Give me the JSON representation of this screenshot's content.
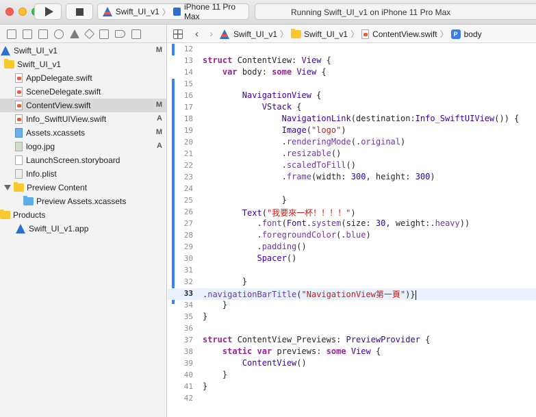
{
  "toolbar": {
    "scheme_name": "Swift_UI_v1",
    "scheme_separator": "〉",
    "device_name": "iPhone 11 Pro Max",
    "status_text": "Running Swift_UI_v1 on iPhone 11 Pro Max"
  },
  "navigator": {
    "tabs": [
      "folder-icon",
      "source-control-icon",
      "symbol-icon",
      "find-icon",
      "issue-icon",
      "test-icon",
      "debug-icon",
      "breakpoint-icon",
      "report-icon"
    ],
    "items": [
      {
        "label": "Swift_UI_v1",
        "badge": "M",
        "kind": "project",
        "indent": 0
      },
      {
        "label": "Swift_UI_v1",
        "badge": "",
        "kind": "folder",
        "indent": 1
      },
      {
        "label": "AppDelegate.swift",
        "badge": "",
        "kind": "swift",
        "indent": 2
      },
      {
        "label": "SceneDelegate.swift",
        "badge": "",
        "kind": "swift",
        "indent": 2
      },
      {
        "label": "ContentView.swift",
        "badge": "M",
        "kind": "swift",
        "indent": 2,
        "selected": true
      },
      {
        "label": "Info_SwiftUIView.swift",
        "badge": "A",
        "kind": "swift",
        "indent": 2
      },
      {
        "label": "Assets.xcassets",
        "badge": "M",
        "kind": "xcassets",
        "indent": 2
      },
      {
        "label": "logo.jpg",
        "badge": "A",
        "kind": "img",
        "indent": 2
      },
      {
        "label": "LaunchScreen.storyboard",
        "badge": "",
        "kind": "sb",
        "indent": 2
      },
      {
        "label": "Info.plist",
        "badge": "",
        "kind": "plist",
        "indent": 2
      },
      {
        "label": "Preview Content",
        "badge": "",
        "kind": "folder-open",
        "indent": 1
      },
      {
        "label": "Preview Assets.xcassets",
        "badge": "",
        "kind": "folder-blue",
        "indent": 3
      },
      {
        "label": "Products",
        "badge": "",
        "kind": "folder",
        "indent": 0
      },
      {
        "label": "Swift_UI_v1.app",
        "badge": "",
        "kind": "app",
        "indent": 2
      }
    ]
  },
  "jumpbar": {
    "path": [
      "Swift_UI_v1",
      "Swift_UI_v1",
      "ContentView.swift",
      "body"
    ],
    "symbol_badge": "P"
  },
  "editor": {
    "current_line": 33,
    "lines": [
      {
        "n": 12,
        "code": ""
      },
      {
        "n": 13,
        "code": "<span class=\"kw\">struct</span> ContentView: <span class=\"ty\">View</span> {"
      },
      {
        "n": 14,
        "code": "    <span class=\"kw\">var</span> body: <span class=\"kw\">some</span> <span class=\"ty\">View</span> {"
      },
      {
        "n": 15,
        "code": ""
      },
      {
        "n": 16,
        "code": "        <span class=\"ty\">NavigationView</span> {"
      },
      {
        "n": 17,
        "code": "            <span class=\"ty\">VStack</span> {"
      },
      {
        "n": 18,
        "code": "                <span class=\"ty\">NavigationLink</span>(destination:<span class=\"ty\">Info_SwiftUIView</span>()) {"
      },
      {
        "n": 19,
        "code": "                <span class=\"ty\">Image</span>(<span class=\"st\">\"logo\"</span>)"
      },
      {
        "n": 20,
        "code": "                .<span class=\"fn\">renderingMode</span>(.<span class=\"fn\">original</span>)"
      },
      {
        "n": 21,
        "code": "                .<span class=\"fn\">resizable</span>()"
      },
      {
        "n": 22,
        "code": "                .<span class=\"fn\">scaledToFill</span>()"
      },
      {
        "n": 23,
        "code": "                .<span class=\"fn\">frame</span>(width: <span class=\"nm\">300</span>, height: <span class=\"nm\">300</span>)"
      },
      {
        "n": 24,
        "code": ""
      },
      {
        "n": 25,
        "code": "                }"
      },
      {
        "n": 26,
        "code": "        <span class=\"ty\">Text</span>(<span class=\"st\">\"我要來一杯！！！！\"</span>)"
      },
      {
        "n": 27,
        "code": "           .<span class=\"fn\">font</span>(<span class=\"ty\">Font</span>.<span class=\"fn\">system</span>(size: <span class=\"nm\">30</span>, weight:.<span class=\"fn\">heavy</span>))"
      },
      {
        "n": 28,
        "code": "           .<span class=\"fn\">foregroundColor</span>(.<span class=\"fn\">blue</span>)"
      },
      {
        "n": 29,
        "code": "           .<span class=\"fn\">padding</span>()"
      },
      {
        "n": 30,
        "code": "           <span class=\"ty\">Spacer</span>()"
      },
      {
        "n": 31,
        "code": ""
      },
      {
        "n": 32,
        "code": "        }"
      },
      {
        "n": 33,
        "code": ".<span class=\"fn\">navigationBarTitle</span>(<span class=\"st\">\"NavigationView第一頁\"</span>)}<span class=\"caret\"></span>"
      },
      {
        "n": 34,
        "code": "    }"
      },
      {
        "n": 35,
        "code": "}"
      },
      {
        "n": 36,
        "code": ""
      },
      {
        "n": 37,
        "code": "<span class=\"kw\">struct</span> ContentView_Previews: <span class=\"ty\">PreviewProvider</span> {"
      },
      {
        "n": 38,
        "code": "    <span class=\"kw\">static</span> <span class=\"kw\">var</span> previews: <span class=\"kw\">some</span> <span class=\"ty\">View</span> {"
      },
      {
        "n": 39,
        "code": "        <span class=\"ty\">ContentView</span>()"
      },
      {
        "n": 40,
        "code": "    }"
      },
      {
        "n": 41,
        "code": "}"
      },
      {
        "n": 42,
        "code": ""
      }
    ]
  }
}
